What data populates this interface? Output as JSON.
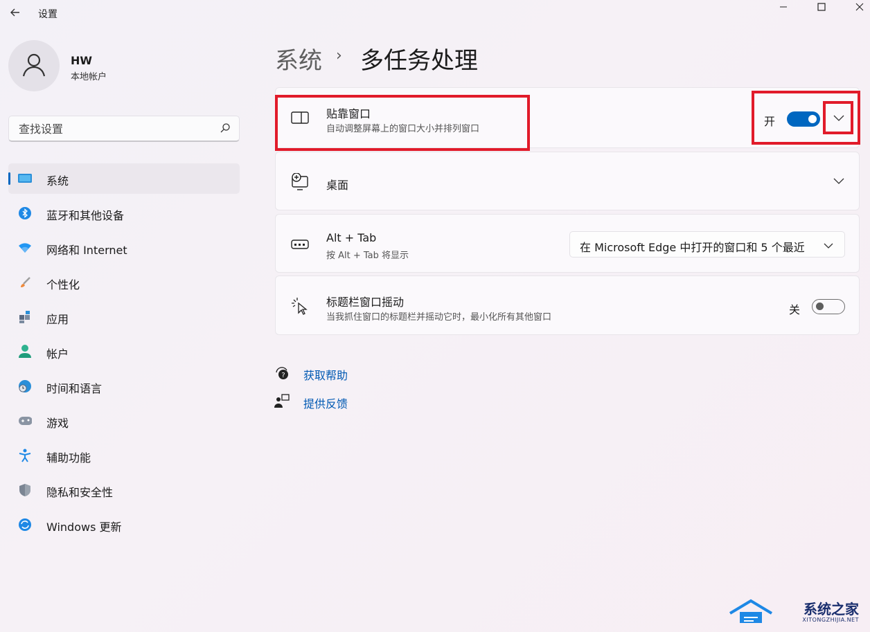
{
  "window": {
    "app_title": "设置"
  },
  "user": {
    "name": "HW",
    "account_type": "本地帐户"
  },
  "search": {
    "placeholder": "查找设置"
  },
  "sidebar": {
    "items": [
      {
        "label": "系统",
        "icon": "system-icon",
        "active": true
      },
      {
        "label": "蓝牙和其他设备",
        "icon": "bluetooth-icon"
      },
      {
        "label": "网络和 Internet",
        "icon": "wifi-icon"
      },
      {
        "label": "个性化",
        "icon": "brush-icon"
      },
      {
        "label": "应用",
        "icon": "apps-icon"
      },
      {
        "label": "帐户",
        "icon": "account-icon"
      },
      {
        "label": "时间和语言",
        "icon": "globe-clock-icon"
      },
      {
        "label": "游戏",
        "icon": "gamepad-icon"
      },
      {
        "label": "辅助功能",
        "icon": "accessibility-icon"
      },
      {
        "label": "隐私和安全性",
        "icon": "shield-icon"
      },
      {
        "label": "Windows 更新",
        "icon": "update-icon"
      }
    ]
  },
  "breadcrumb": {
    "root": "系统",
    "separator": "›",
    "current": "多任务处理"
  },
  "settings": {
    "snap": {
      "title": "贴靠窗口",
      "desc": "自动调整屏幕上的窗口大小并排列窗口",
      "state_label": "开",
      "on": true
    },
    "desktops": {
      "title": "桌面"
    },
    "alttab": {
      "title": "Alt + Tab",
      "desc": "按 Alt + Tab 将显示",
      "value": "在 Microsoft Edge 中打开的窗口和 5 个最近"
    },
    "shake": {
      "title": "标题栏窗口摇动",
      "desc": "当我抓住窗口的标题栏并摇动它时，最小化所有其他窗口",
      "state_label": "关",
      "on": false
    }
  },
  "links": {
    "help": "获取帮助",
    "feedback": "提供反馈"
  },
  "watermark": {
    "name": "系统之家",
    "domain": "XITONGZHIJIA.NET"
  },
  "colors": {
    "accent": "#0067c0",
    "highlight": "#e11b2a"
  }
}
